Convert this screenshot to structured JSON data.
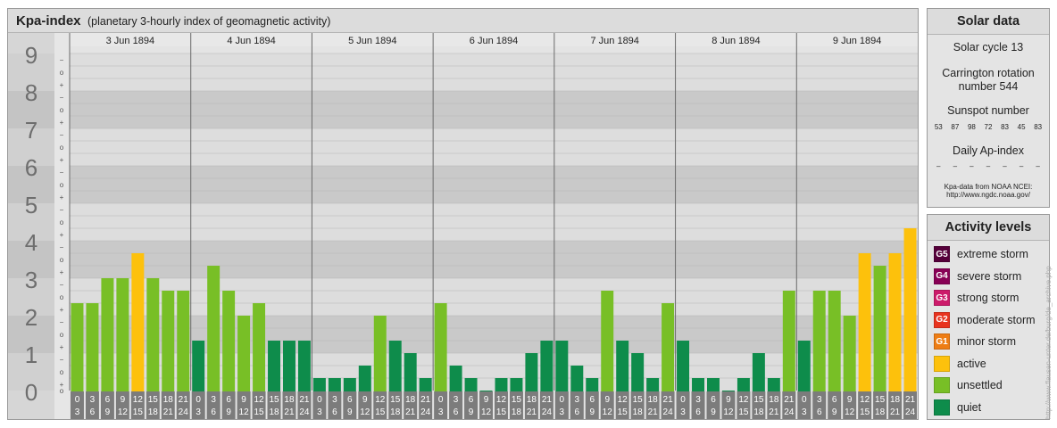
{
  "chart_data": {
    "type": "bar",
    "title": "Kpa-index",
    "subtitle": "(planetary 3-hourly index of geomagnetic activity)",
    "y_range": [
      0,
      9
    ],
    "y_ticks": [
      "0",
      "1",
      "2",
      "3",
      "4",
      "5",
      "6",
      "7",
      "8",
      "9"
    ],
    "sub_ticks": [
      "+",
      "o",
      "−"
    ],
    "days": [
      "3 Jun 1894",
      "4 Jun 1894",
      "5 Jun 1894",
      "6 Jun 1894",
      "7 Jun 1894",
      "8 Jun 1894",
      "9 Jun 1894"
    ],
    "hour_starts": [
      "0",
      "3",
      "6",
      "9",
      "12",
      "15",
      "18",
      "21"
    ],
    "hour_ends": [
      "3",
      "6",
      "9",
      "12",
      "15",
      "18",
      "21",
      "24"
    ],
    "values": [
      [
        2.333,
        2.333,
        3.0,
        3.0,
        3.667,
        3.0,
        2.667,
        2.667
      ],
      [
        1.333,
        3.333,
        2.667,
        2.0,
        2.333,
        1.333,
        1.333,
        1.333
      ],
      [
        0.333,
        0.333,
        0.333,
        0.667,
        2.0,
        1.333,
        1.0,
        0.333
      ],
      [
        2.333,
        0.667,
        0.333,
        0.0,
        0.333,
        0.333,
        1.0,
        1.333
      ],
      [
        1.333,
        0.667,
        0.333,
        2.667,
        1.333,
        1.0,
        0.333,
        2.333
      ],
      [
        1.333,
        0.333,
        0.333,
        0.0,
        0.333,
        1.0,
        0.333,
        2.667
      ],
      [
        1.333,
        2.667,
        2.667,
        2.0,
        3.667,
        3.333,
        3.667,
        4.333
      ]
    ],
    "colors": {
      "quiet": "#0e8c4b",
      "unsettled": "#78bf26",
      "active": "#fdc10c",
      "plot_band_dark": "#c9c9c9",
      "plot_band_light": "#dddddd",
      "label_bar": "#7c7c7c"
    }
  },
  "solar": {
    "heading": "Solar data",
    "cycle": "Solar cycle 13",
    "rotation_line1": "Carrington rotation",
    "rotation_line2": "number 544",
    "sunspot_label": "Sunspot number",
    "sunspot_values": [
      "53",
      "87",
      "98",
      "72",
      "83",
      "45",
      "83"
    ],
    "ap_label": "Daily Ap-index",
    "ap_values": [
      "–",
      "–",
      "–",
      "–",
      "–",
      "–",
      "–"
    ],
    "source_line1": "Kpa-data from NOAA NCEI:",
    "source_line2": "http://www.ngdc.noaa.gov/"
  },
  "activity": {
    "heading": "Activity levels",
    "levels": [
      {
        "code": "G5",
        "label": "extreme storm",
        "color": "#55003a"
      },
      {
        "code": "G4",
        "label": "severe storm",
        "color": "#880055"
      },
      {
        "code": "G3",
        "label": "strong storm",
        "color": "#cc1a6a"
      },
      {
        "code": "G2",
        "label": "moderate storm",
        "color": "#e8331e"
      },
      {
        "code": "G1",
        "label": "minor storm",
        "color": "#ee7d14"
      },
      {
        "code": "",
        "label": "active",
        "color": "#fdc10c"
      },
      {
        "code": "",
        "label": "unsettled",
        "color": "#78bf26"
      },
      {
        "code": "",
        "label": "quiet",
        "color": "#0e8c4b"
      }
    ]
  },
  "credit": "http://www.flausen-unter.de/burg/de_archive.php"
}
